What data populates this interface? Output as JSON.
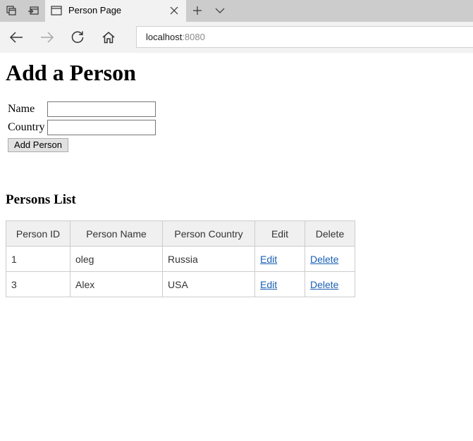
{
  "browser": {
    "tab_title": "Person Page",
    "address_host": "localhost",
    "address_port": ":8080"
  },
  "page": {
    "heading": "Add a Person",
    "form": {
      "name_label": "Name",
      "name_value": "",
      "country_label": "Country",
      "country_value": "",
      "submit_label": "Add Person"
    },
    "list_heading": "Persons List",
    "table": {
      "headers": [
        "Person ID",
        "Person Name",
        "Person Country",
        "Edit",
        "Delete"
      ],
      "rows": [
        {
          "id": "1",
          "name": "oleg",
          "country": "Russia",
          "edit": "Edit",
          "delete": "Delete"
        },
        {
          "id": "3",
          "name": "Alex",
          "country": "USA",
          "edit": "Edit",
          "delete": "Delete"
        }
      ]
    }
  },
  "icons": {
    "tab_manager": "tab-manager-icon",
    "set_aside": "set-aside-tabs-icon",
    "page": "page-icon",
    "close": "close-icon",
    "new_tab": "plus-icon",
    "tab_list": "chevron-down-icon",
    "back": "back-arrow-icon",
    "forward": "forward-arrow-icon",
    "refresh": "refresh-icon",
    "home": "home-icon"
  }
}
